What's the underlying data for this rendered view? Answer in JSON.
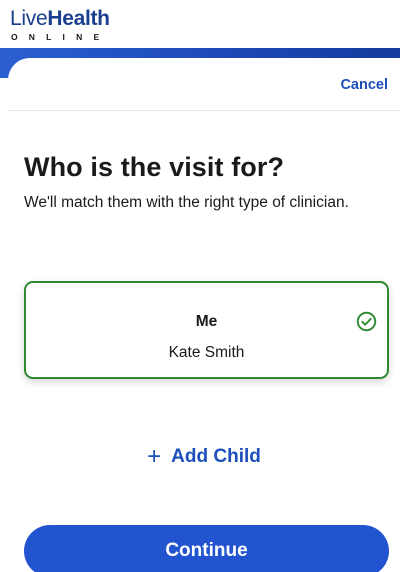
{
  "brand": {
    "logo_part1": "Live",
    "logo_part2": "Health",
    "logo_sub": "ONLINE"
  },
  "header": {
    "cancel_label": "Cancel"
  },
  "main": {
    "title": "Who is the visit for?",
    "subtitle": "We'll match them with the right type of clinician."
  },
  "selection_card": {
    "title": "Me",
    "name": "Kate Smith",
    "selected": true,
    "icon": "check-circle-icon"
  },
  "add_child": {
    "icon": "plus-icon",
    "label": "Add Child"
  },
  "footer": {
    "continue_label": "Continue"
  },
  "colors": {
    "brand_blue": "#1c4fb9",
    "button_blue": "#2354cf",
    "selected_green": "#2f8a2f"
  }
}
